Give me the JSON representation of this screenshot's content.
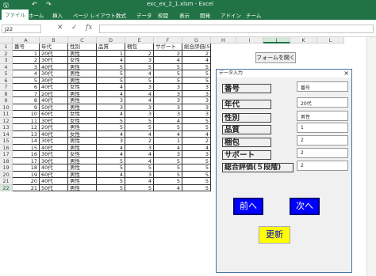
{
  "window": {
    "title": "exc_ex_2_1.xlsm - Excel"
  },
  "ribbon": {
    "tabs": [
      "ファイル",
      "ホーム",
      "挿入",
      "ページ レイアウト",
      "数式",
      "データ",
      "校閲",
      "表示",
      "開発",
      "アドイン",
      "チーム"
    ],
    "active_tab": "ファイル"
  },
  "formula_bar": {
    "name_box": "J22",
    "formula": ""
  },
  "sheet": {
    "columns": [
      "A",
      "B",
      "C",
      "D",
      "E",
      "F",
      "G",
      "H",
      "I",
      "J",
      "K",
      "L"
    ],
    "headers": [
      "番号",
      "年代",
      "性別",
      "品質",
      "梱包",
      "サポート",
      "総合評価(5段階)"
    ],
    "rows": [
      [
        "1",
        "20代",
        "男性",
        "1",
        "2",
        "2",
        "2"
      ],
      [
        "2",
        "30代",
        "女性",
        "4",
        "3",
        "4",
        "4"
      ],
      [
        "3",
        "40代",
        "男性",
        "5",
        "5",
        "5",
        "5"
      ],
      [
        "4",
        "30代",
        "男性",
        "5",
        "4",
        "5",
        "5"
      ],
      [
        "5",
        "30代",
        "男性",
        "5",
        "5",
        "5",
        "5"
      ],
      [
        "6",
        "40代",
        "女性",
        "4",
        "3",
        "3",
        "3"
      ],
      [
        "7",
        "20代",
        "男性",
        "4",
        "4",
        "3",
        "3"
      ],
      [
        "8",
        "40代",
        "男性",
        "3",
        "4",
        "3",
        "3"
      ],
      [
        "9",
        "50代",
        "男性",
        "3",
        "3",
        "3",
        "3"
      ],
      [
        "10",
        "60代",
        "女性",
        "4",
        "3",
        "3",
        "3"
      ],
      [
        "11",
        "30代",
        "女性",
        "5",
        "5",
        "4",
        "5"
      ],
      [
        "12",
        "20代",
        "男性",
        "5",
        "5",
        "5",
        "5"
      ],
      [
        "13",
        "40代",
        "女性",
        "4",
        "4",
        "4",
        "4"
      ],
      [
        "14",
        "30代",
        "男性",
        "3",
        "2",
        "1",
        "2"
      ],
      [
        "15",
        "40代",
        "男性",
        "4",
        "3",
        "4",
        "4"
      ],
      [
        "16",
        "30代",
        "女性",
        "4",
        "4",
        "3",
        "3"
      ],
      [
        "17",
        "30代",
        "男性",
        "5",
        "4",
        "5",
        "5"
      ],
      [
        "18",
        "40代",
        "男性",
        "5",
        "5",
        "5",
        "5"
      ],
      [
        "19",
        "60代",
        "男性",
        "4",
        "3",
        "5",
        "5"
      ],
      [
        "20",
        "40代",
        "男性",
        "5",
        "4",
        "5",
        "5"
      ],
      [
        "21",
        "50代",
        "男性",
        "5",
        "5",
        "4",
        "5"
      ]
    ],
    "row_numbers": [
      "1",
      "2",
      "3",
      "4",
      "5",
      "6",
      "7",
      "8",
      "9",
      "10",
      "11",
      "12",
      "13",
      "14",
      "15",
      "16",
      "17",
      "18",
      "19",
      "20",
      "21",
      "22"
    ]
  },
  "form_button": {
    "label": "フォームを開く"
  },
  "dialog": {
    "title": "データ入力",
    "close": "×",
    "fields": [
      {
        "label": "番号",
        "value": "番号"
      },
      {
        "label": "年代",
        "value": "20代"
      },
      {
        "label": "性別",
        "value": "男性"
      },
      {
        "label": "品質",
        "value": "1"
      },
      {
        "label": "梱包",
        "value": "2"
      },
      {
        "label": "サポート",
        "value": "2"
      },
      {
        "label": "総合評価(５段階)",
        "value": "2"
      }
    ],
    "prev_label": "前へ",
    "next_label": "次へ",
    "update_label": "更新"
  }
}
